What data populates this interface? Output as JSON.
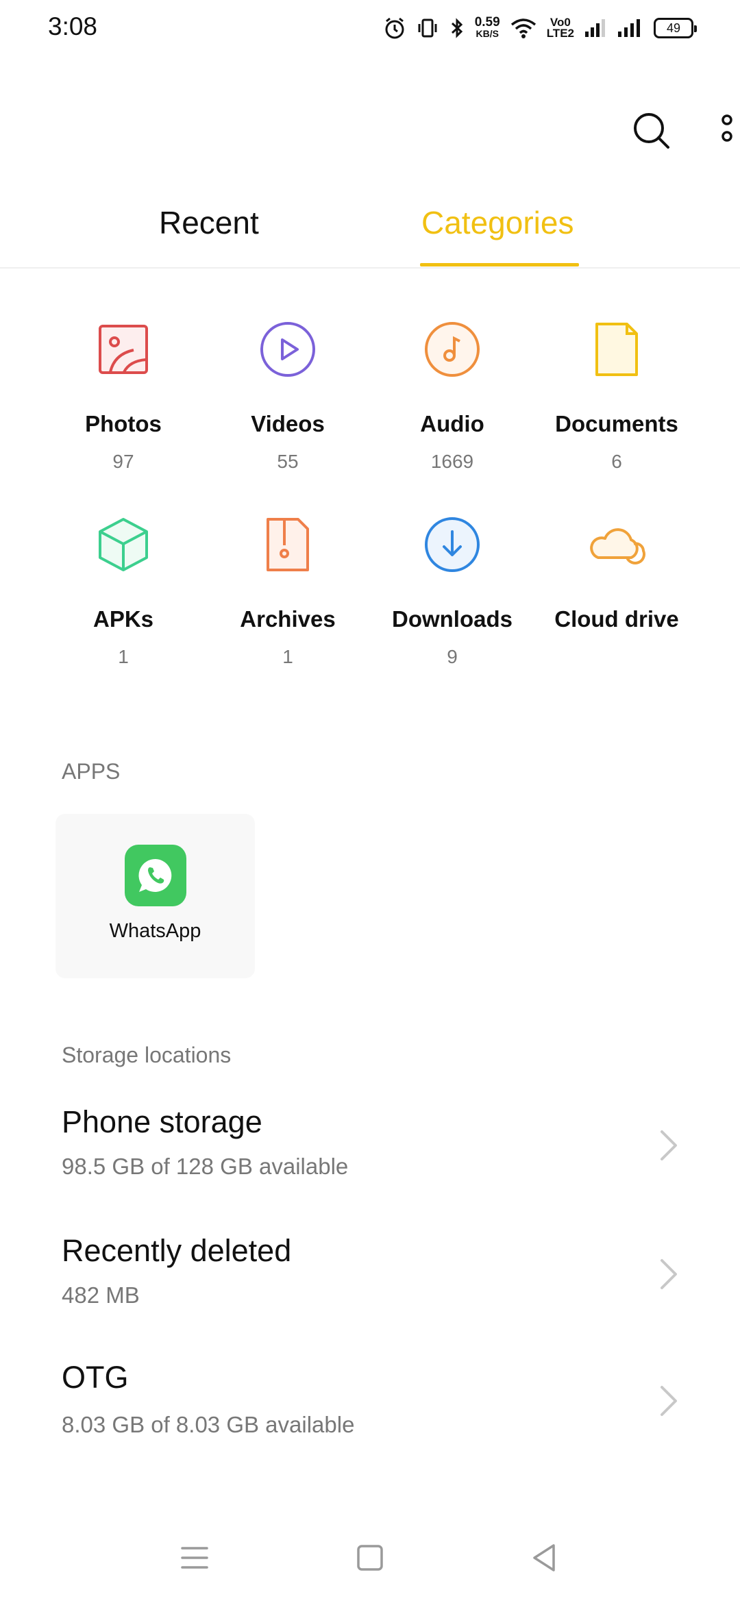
{
  "status_bar": {
    "time": "3:08",
    "net_speed": "0.59",
    "net_speed_unit": "KB/S",
    "volte_top": "Vo0",
    "volte_bottom": "LTE2",
    "battery": "49"
  },
  "tabs": {
    "recent_label": "Recent",
    "categories_label": "Categories",
    "active": "Categories"
  },
  "categories": [
    {
      "label": "Photos",
      "count": "97",
      "icon": "photos-icon",
      "color": "#dc4c4c"
    },
    {
      "label": "Videos",
      "count": "55",
      "icon": "videos-icon",
      "color": "#7b61d9"
    },
    {
      "label": "Audio",
      "count": "1669",
      "icon": "audio-icon",
      "color": "#ef8f3d"
    },
    {
      "label": "Documents",
      "count": "6",
      "icon": "documents-icon",
      "color": "#f1c012"
    },
    {
      "label": "APKs",
      "count": "1",
      "icon": "apk-icon",
      "color": "#3ccf8e"
    },
    {
      "label": "Archives",
      "count": "1",
      "icon": "archives-icon",
      "color": "#ef7f4a"
    },
    {
      "label": "Downloads",
      "count": "9",
      "icon": "downloads-icon",
      "color": "#2f86e0"
    },
    {
      "label": "Cloud drive",
      "count": "",
      "icon": "cloud-drive-icon",
      "color": "#f0a23a"
    }
  ],
  "apps": {
    "section_title": "APPS",
    "items": [
      {
        "name": "WhatsApp",
        "icon": "whatsapp-icon",
        "color": "#41c860"
      }
    ]
  },
  "storage": {
    "section_title": "Storage locations",
    "items": [
      {
        "title": "Phone storage",
        "subtitle": "98.5 GB of 128 GB available"
      },
      {
        "title": "Recently deleted",
        "subtitle": "482 MB"
      },
      {
        "title": "OTG",
        "subtitle": "8.03 GB of 8.03 GB available"
      }
    ]
  },
  "colors": {
    "accent": "#f1c012",
    "text_secondary": "#777777"
  }
}
